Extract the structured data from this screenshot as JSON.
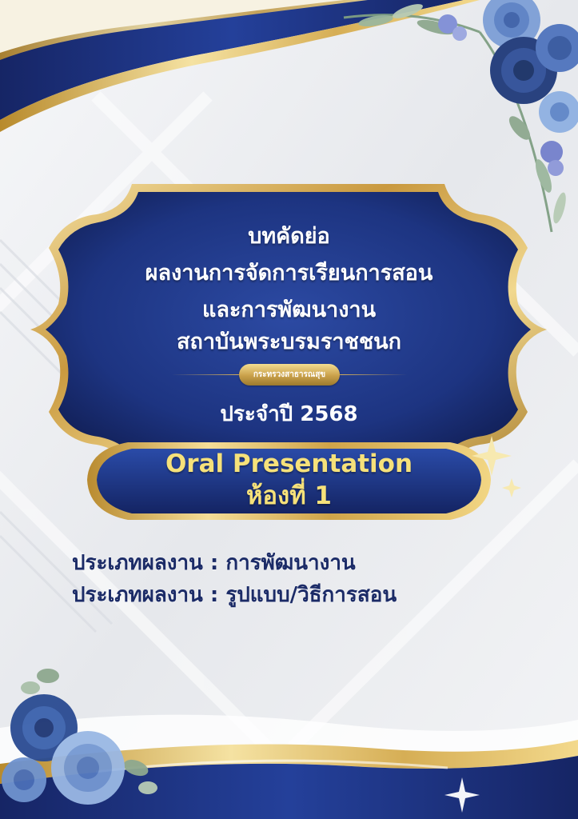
{
  "poster": {
    "title_lines": [
      "บทคัดย่อ",
      "ผลงานการจัดการเรียนการสอน",
      "และการพัฒนางาน",
      "สถาบันพระบรมราชชนก"
    ],
    "ministry_badge": "กระทรวงสาธารณสุข",
    "year_label": "ประจำปี 2568",
    "presentation": {
      "line1": "Oral Presentation",
      "line2": "ห้องที่ 1"
    },
    "categories": [
      "ประเภทผลงาน : การพัฒนางาน",
      "ประเภทผลงาน : รูปแบบ/วิธีการสอน"
    ]
  },
  "colors": {
    "navy": "#1b2f78",
    "navy_dark": "#14225a",
    "gold": "#d4ae5a",
    "gold_light": "#f3dd91",
    "oral_text": "#f6e17a",
    "category_text": "#1b2b67",
    "background": "#f1f2f5"
  },
  "icons": [
    "blue-rose-bouquet-top-right",
    "blue-rose-bouquet-bottom-left",
    "sparkle-star"
  ]
}
